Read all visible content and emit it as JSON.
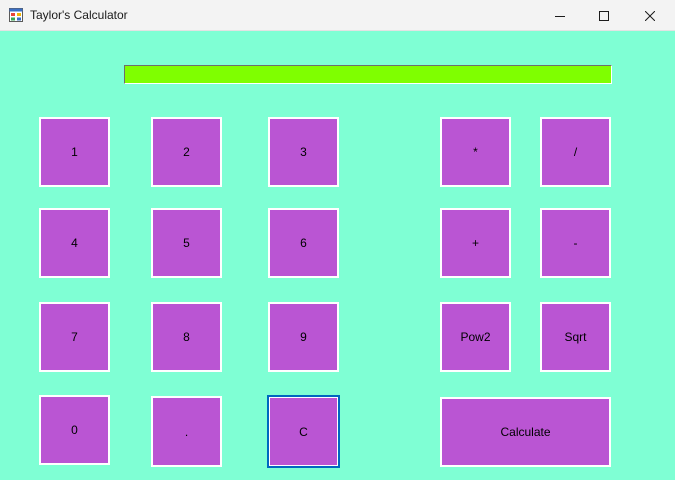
{
  "window": {
    "title": "Taylor's Calculator",
    "icon": "form-icon",
    "controls": [
      "minimize-icon",
      "maximize-icon",
      "close-icon"
    ]
  },
  "display": {
    "value": ""
  },
  "keys": {
    "k1": "1",
    "k2": "2",
    "k3": "3",
    "k4": "4",
    "k5": "5",
    "k6": "6",
    "k7": "7",
    "k8": "8",
    "k9": "9",
    "k0": "0",
    "dot": ".",
    "clear": "C",
    "multiply": "*",
    "divide": "/",
    "add": "+",
    "subtract": "-",
    "pow2": "Pow2",
    "sqrt": "Sqrt",
    "calculate": "Calculate"
  },
  "focused_key": "clear",
  "colors": {
    "background": "#7fffd4",
    "button": "#ba55d3",
    "display": "#7fff00",
    "focus": "#0067c0"
  }
}
